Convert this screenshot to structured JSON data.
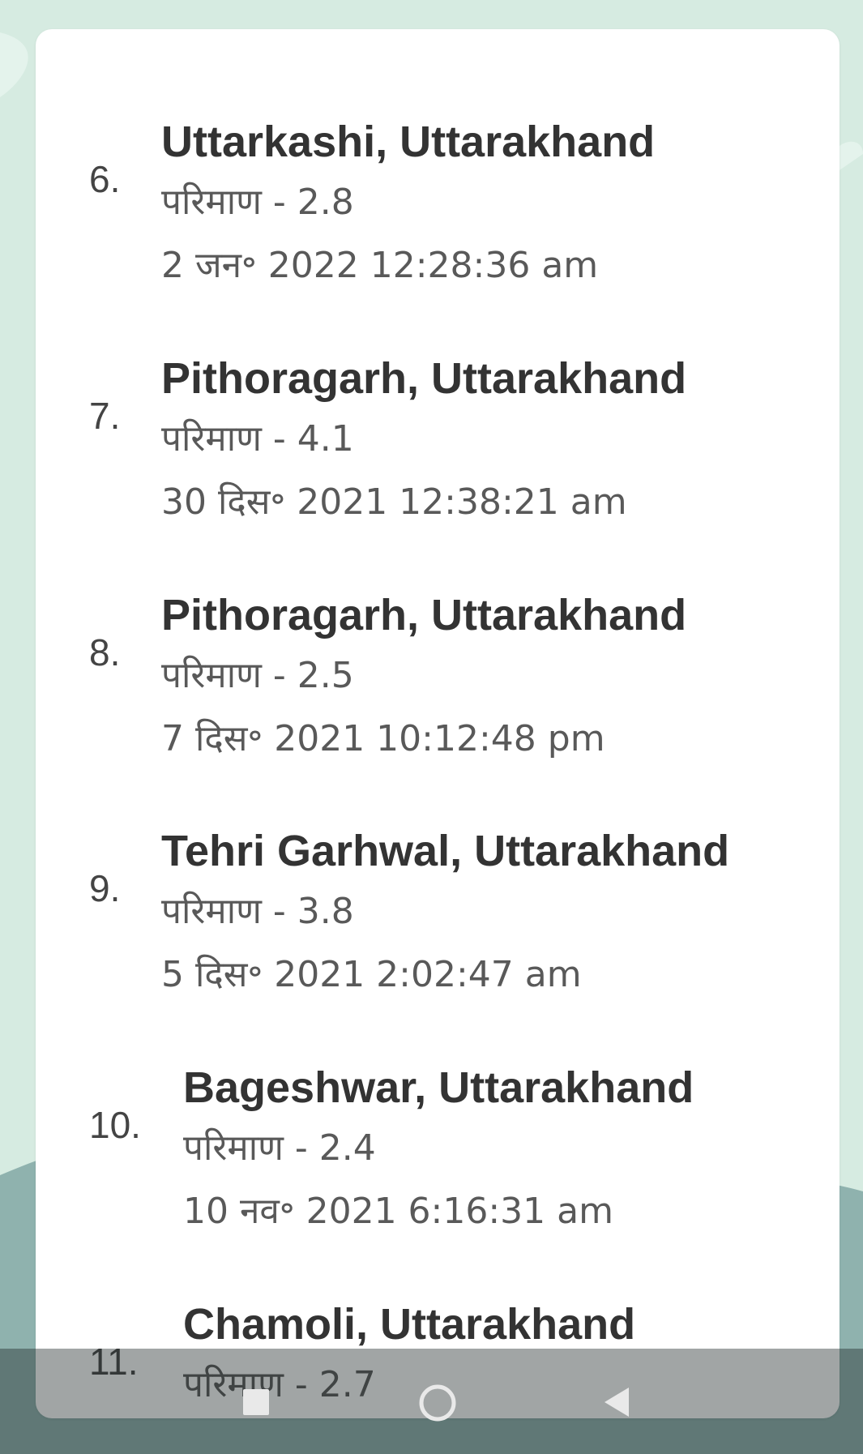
{
  "earthquakes": [
    {
      "rank": "6.",
      "place": "Uttarkashi, Uttarakhand",
      "magnitude": "परिमाण - 2.8",
      "time": "2 जन॰ 2022 12:28:36 am"
    },
    {
      "rank": "7.",
      "place": "Pithoragarh, Uttarakhand",
      "magnitude": "परिमाण - 4.1",
      "time": "30 दिस॰ 2021 12:38:21 am"
    },
    {
      "rank": "8.",
      "place": "Pithoragarh, Uttarakhand",
      "magnitude": "परिमाण - 2.5",
      "time": "7 दिस॰ 2021 10:12:48 pm"
    },
    {
      "rank": "9.",
      "place": "Tehri Garhwal, Uttarakhand",
      "magnitude": "परिमाण - 3.8",
      "time": "5 दिस॰ 2021 2:02:47 am"
    },
    {
      "rank": "10.",
      "place": "Bageshwar, Uttarakhand",
      "magnitude": "परिमाण - 2.4",
      "time": "10 नव॰ 2021 6:16:31 am"
    },
    {
      "rank": "11.",
      "place": "Chamoli, Uttarakhand",
      "magnitude": "परिमाण - 2.7",
      "time": ""
    }
  ],
  "navbar": {
    "recent_icon": "square-icon",
    "home_icon": "circle-icon",
    "back_icon": "triangle-back-icon"
  },
  "colors": {
    "background": "#d6ebe1",
    "card": "#ffffff",
    "title_text": "#333333",
    "detail_text": "#595959",
    "hills": "#8fb2ae"
  }
}
